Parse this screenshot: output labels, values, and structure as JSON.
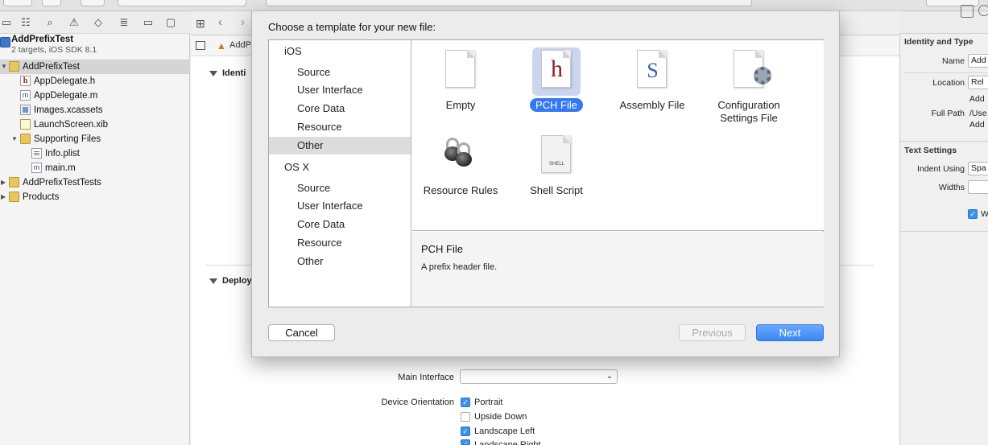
{
  "navigator": {
    "project_name": "AddPrefixTest",
    "project_subtitle": "2 targets, iOS SDK 8.1",
    "items": [
      {
        "label": "AddPrefixTest"
      },
      {
        "label": "AppDelegate.h"
      },
      {
        "label": "AppDelegate.m"
      },
      {
        "label": "Images.xcassets"
      },
      {
        "label": "LaunchScreen.xib"
      },
      {
        "label": "Supporting Files"
      },
      {
        "label": "Info.plist"
      },
      {
        "label": "main.m"
      },
      {
        "label": "AddPrefixTestTests"
      },
      {
        "label": "Products"
      }
    ]
  },
  "editor": {
    "breadcrumb": "AddP",
    "section1_title": "Identi",
    "section2_title": "Deploy",
    "main_interface_label": "Main Interface",
    "main_interface_value": "",
    "device_orientation_label": "Device Orientation",
    "orientations": [
      {
        "label": "Portrait",
        "checked": true
      },
      {
        "label": "Upside Down",
        "checked": false
      },
      {
        "label": "Landscape Left",
        "checked": true
      },
      {
        "label": "Landscape Right",
        "checked": true
      }
    ]
  },
  "inspector": {
    "identity_title": "Identity and Type",
    "name_label": "Name",
    "name_value": "Add",
    "location_label": "Location",
    "location_value": "Rel",
    "location_path": "Add",
    "full_path_label": "Full Path",
    "full_path_value": "/Use",
    "full_path_value2": "Add",
    "text_settings_title": "Text Settings",
    "indent_label": "Indent Using",
    "indent_value": "Spa",
    "widths_label": "Widths",
    "wrap_label": "W"
  },
  "dialog": {
    "title": "Choose a template for your new file:",
    "categories": {
      "ios_header": "iOS",
      "ios_items": [
        "Source",
        "User Interface",
        "Core Data",
        "Resource",
        "Other"
      ],
      "osx_header": "OS X",
      "osx_items": [
        "Source",
        "User Interface",
        "Core Data",
        "Resource",
        "Other"
      ],
      "selected": "iOS / Other"
    },
    "templates": [
      {
        "name": "Empty",
        "icon": "empty-file-icon",
        "selected": false
      },
      {
        "name": "PCH File",
        "icon": "pch-file-icon",
        "selected": true
      },
      {
        "name": "Assembly File",
        "icon": "assembly-file-icon",
        "selected": false
      },
      {
        "name_line1": "Configuration",
        "name_line2": "Settings File",
        "icon": "configuration-settings-icon",
        "selected": false
      },
      {
        "name": "Resource Rules",
        "icon": "resource-rules-icon",
        "selected": false
      },
      {
        "name": "Shell Script",
        "icon": "shell-script-icon",
        "selected": false
      }
    ],
    "pch_glyph": "h",
    "assembly_glyph": "S",
    "shell_glyph": "SHELL",
    "description_title": "PCH File",
    "description_text": "A prefix header file.",
    "buttons": {
      "cancel": "Cancel",
      "previous": "Previous",
      "next": "Next"
    },
    "accent_color": "#3478f6"
  }
}
